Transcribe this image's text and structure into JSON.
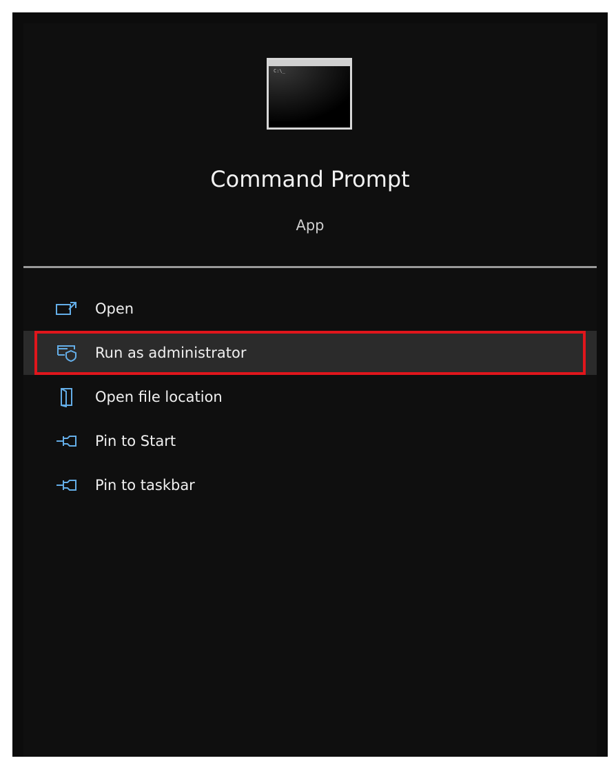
{
  "app": {
    "title": "Command Prompt",
    "type": "App",
    "icon": "command-prompt-icon",
    "prompt_glyph": "C:\\_"
  },
  "menu": {
    "items": [
      {
        "label": "Open",
        "icon": "open-icon"
      },
      {
        "label": "Run as administrator",
        "icon": "shield-window-icon",
        "highlighted": true
      },
      {
        "label": "Open file location",
        "icon": "folder-location-icon"
      },
      {
        "label": "Pin to Start",
        "icon": "pin-icon"
      },
      {
        "label": "Pin to taskbar",
        "icon": "pin-icon"
      }
    ]
  },
  "colors": {
    "background": "#0f0f0f",
    "icon_accent": "#64aee8",
    "highlight_border": "#e0161c",
    "highlight_fill": "#2b2b2b",
    "text": "#f0f0f0"
  }
}
